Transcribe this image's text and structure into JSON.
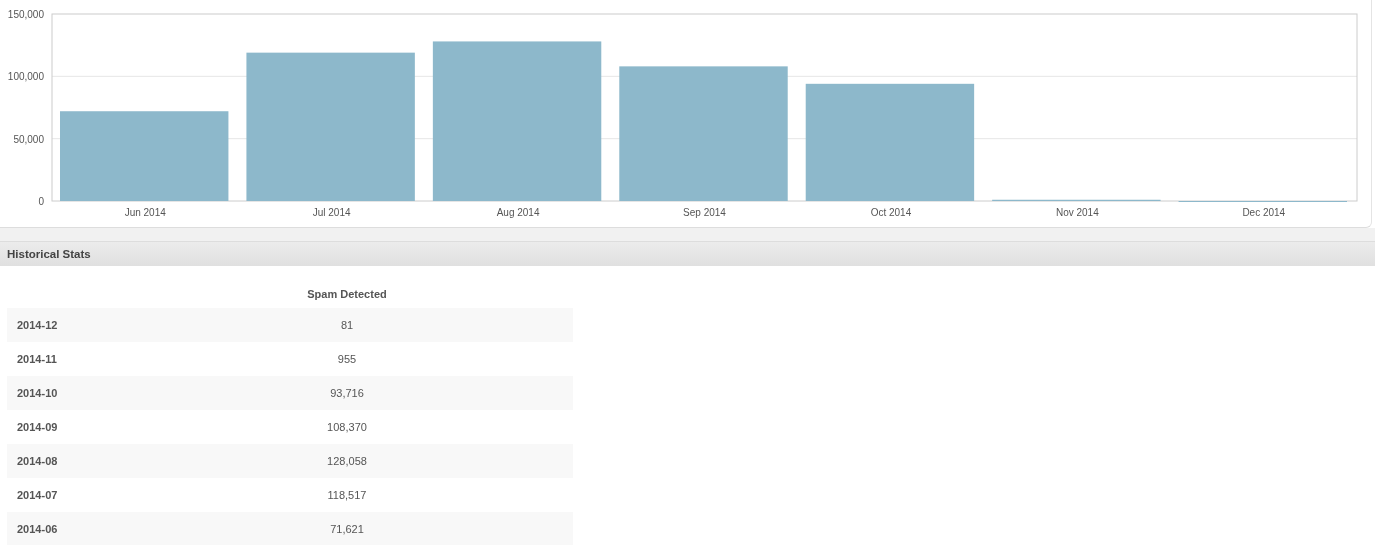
{
  "chart": {
    "chart_data": {
      "type": "bar",
      "categories": [
        "Jun 2014",
        "Jul 2014",
        "Aug 2014",
        "Sep 2014",
        "Oct 2014",
        "Nov 2014",
        "Dec 2014"
      ],
      "series": [
        {
          "color": "#8db8cb",
          "values": [
            72000,
            119000,
            128000,
            108000,
            94000,
            1000,
            0
          ]
        }
      ],
      "ylim": [
        0,
        150000
      ],
      "yticks": [
        {
          "value": 0,
          "label": "0"
        },
        {
          "value": 50000,
          "label": "50,000"
        },
        {
          "value": 100000,
          "label": "100,000"
        },
        {
          "value": 150000,
          "label": "150,000"
        }
      ]
    }
  },
  "section": {
    "title": "Historical Stats"
  },
  "table": {
    "columns": [
      "Spam Detected"
    ],
    "rows": [
      {
        "period": "2014-12",
        "spam_detected": "81"
      },
      {
        "period": "2014-11",
        "spam_detected": "955"
      },
      {
        "period": "2014-10",
        "spam_detected": "93,716"
      },
      {
        "period": "2014-09",
        "spam_detected": "108,370"
      },
      {
        "period": "2014-08",
        "spam_detected": "128,058"
      },
      {
        "period": "2014-07",
        "spam_detected": "118,517"
      },
      {
        "period": "2014-06",
        "spam_detected": "71,621"
      }
    ]
  }
}
